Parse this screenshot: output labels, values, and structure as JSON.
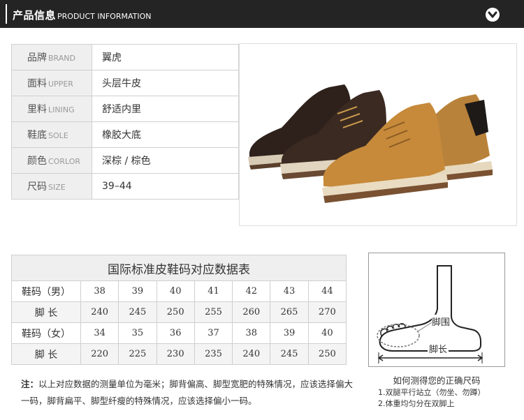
{
  "header": {
    "title": "产品信息",
    "subtitle": "PRODUCT INFORMATION"
  },
  "info_rows": [
    {
      "label_cn": "品牌",
      "label_en": "BRAND",
      "value": "翼虎"
    },
    {
      "label_cn": "面料",
      "label_en": "UPPER",
      "value": "头层牛皮"
    },
    {
      "label_cn": "里料",
      "label_en": "LINING",
      "value": "舒适内里"
    },
    {
      "label_cn": "鞋底",
      "label_en": "SOLE",
      "value": "橡胶大底"
    },
    {
      "label_cn": "颜色",
      "label_en": "CORLOR",
      "value": "深棕 / 棕色"
    },
    {
      "label_cn": "尺码",
      "label_en": "SIZE",
      "value": "39–44"
    }
  ],
  "size_table": {
    "title": "国际标准皮鞋码对应数据表",
    "rows": [
      {
        "label": "鞋码（男）",
        "values": [
          "38",
          "39",
          "40",
          "41",
          "42",
          "43",
          "44"
        ]
      },
      {
        "label": "脚  长",
        "values": [
          "240",
          "245",
          "250",
          "255",
          "260",
          "265",
          "270"
        ]
      },
      {
        "label": "鞋码（女）",
        "values": [
          "34",
          "35",
          "36",
          "37",
          "38",
          "39",
          "40"
        ]
      },
      {
        "label": "脚  长",
        "values": [
          "220",
          "225",
          "230",
          "235",
          "240",
          "245",
          "250"
        ]
      }
    ]
  },
  "note": {
    "prefix": "注：",
    "text": "以上对应数据的测量单位为毫米；脚背偏高、脚型宽肥的特殊情况，应该选择偏大一码，脚背扁平、脚型纤瘦的特殊情况，应该选择偏小一码。"
  },
  "foot_guide": {
    "label_circumference": "脚围",
    "label_length": "脚长",
    "title": "如何测得您的正确尺码",
    "step1": "1.双腿平行站立（勿坐、勿蹲）",
    "step2": "2.体重均匀分在双脚上"
  },
  "colors": {
    "header_bg": "#242424",
    "label_bg": "#efefef",
    "dark_shoe": "#3b2a22",
    "tan_shoe": "#c68a3a"
  }
}
